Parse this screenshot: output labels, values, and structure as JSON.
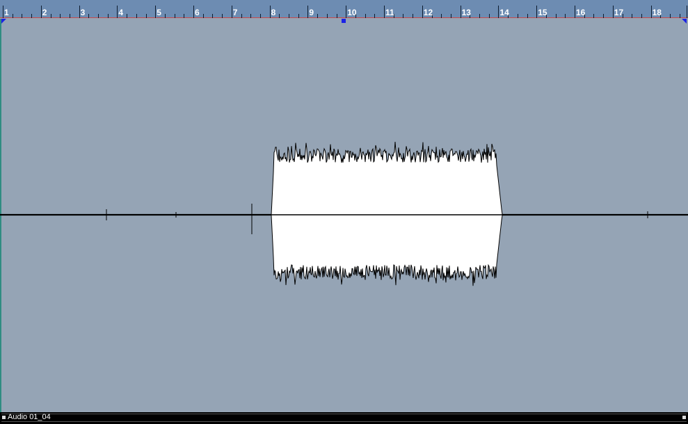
{
  "ruler": {
    "bars": [
      "1",
      "2",
      "3",
      "4",
      "5",
      "6",
      "7",
      "8",
      "9",
      "10",
      "11",
      "12",
      "13",
      "14",
      "15",
      "16",
      "17",
      "18"
    ],
    "current_bar": "10"
  },
  "clip": {
    "name": "Audio 01_04"
  },
  "colors": {
    "background": "#95a4b5",
    "ruler": "#6d8cb2",
    "waveform_fill": "#ffffff",
    "waveform_outline": "#000000",
    "marker": "#1b22e6"
  }
}
